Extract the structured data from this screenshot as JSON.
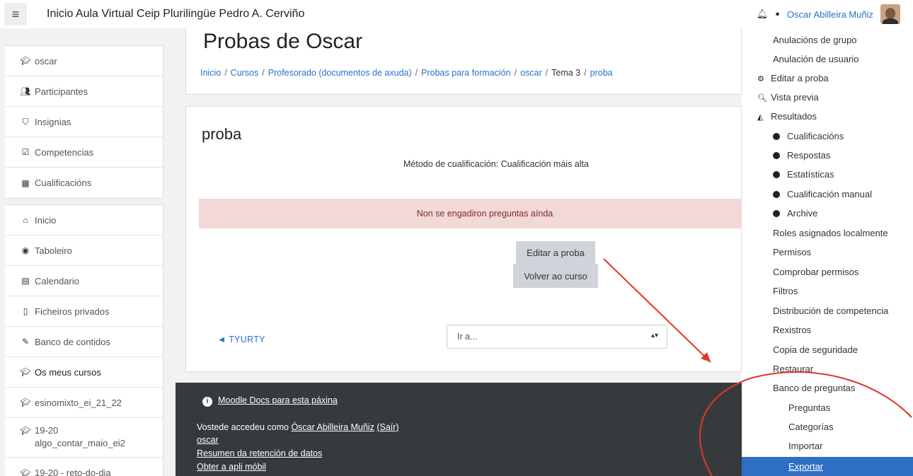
{
  "navbar": {
    "menu_icon": "hamburger-icon",
    "site_title": "Inicio Aula Virtual Ceip Plurilingüe Pedro A. Cerviño",
    "notifications_icon": "bell-icon",
    "messages_icon": "chat-bubble-icon",
    "user_name": "Oscar Abilleira Muñiz"
  },
  "drawer": {
    "group1": [
      {
        "icon": "graduation-cap-icon",
        "glyph": "🎓",
        "label": "oscar"
      },
      {
        "icon": "users-icon",
        "glyph": "👥",
        "label": "Participantes"
      },
      {
        "icon": "shield-icon",
        "glyph": "⛉",
        "label": "Insignias"
      },
      {
        "icon": "checkbox-icon",
        "glyph": "☑",
        "label": "Competencias"
      },
      {
        "icon": "table-icon",
        "glyph": "▦",
        "label": "Cualificacións"
      }
    ],
    "group2": [
      {
        "icon": "home-icon",
        "glyph": "⌂",
        "label": "Inicio"
      },
      {
        "icon": "dashboard-icon",
        "glyph": "◉",
        "label": "Taboleiro"
      },
      {
        "icon": "calendar-icon",
        "glyph": "▤",
        "label": "Calendario"
      },
      {
        "icon": "file-icon",
        "glyph": "🗋",
        "label": "Ficheiros privados"
      },
      {
        "icon": "pencil-icon",
        "glyph": "✎",
        "label": "Banco de contidos"
      },
      {
        "icon": "graduation-cap-icon",
        "glyph": "🎓",
        "label": "Os meus cursos"
      },
      {
        "icon": "graduation-cap-icon",
        "glyph": "🎓",
        "label": "esinomixto_ei_21_22"
      },
      {
        "icon": "graduation-cap-icon",
        "glyph": "🎓",
        "label": "19-20",
        "label2": "algo_contar_maio_ei2"
      },
      {
        "icon": "graduation-cap-icon",
        "glyph": "🎓",
        "label": "19-20 - reto-do-dia"
      }
    ]
  },
  "header": {
    "title": "Probas de Oscar",
    "breadcrumb": [
      "Inicio",
      "Cursos",
      "Profesorado (documentos de axuda)",
      "Probas para formación",
      "oscar",
      "Tema 3",
      "proba"
    ]
  },
  "quiz": {
    "name": "proba",
    "grading_method": "Método de cualificación: Cualificación máis alta",
    "alert": "Non se engadiron preguntas aínda",
    "edit_button": "Editar a proba",
    "back_button": "Volver ao curso",
    "prev_link": "◄ TYURTY",
    "jump_placeholder": "Ir a..."
  },
  "footer": {
    "docs_link": "Moodle Docs para esta páxina",
    "logged_in_prefix": "Vostede accedeu como ",
    "logged_in_user": "Óscar Abilleira Muñiz",
    "logout": "(Saír)",
    "course_link": "oscar",
    "data_retention": "Resumen da retención de datos",
    "mobile_app": "Obter a apli móbil"
  },
  "admin": {
    "items": [
      "Anulacións de grupo",
      "Anulación de usuario",
      "Editar a proba",
      "Vista previa",
      "Resultados",
      "Cualificacións",
      "Respostas",
      "Estatísticas",
      "Cualificación manual",
      "Archive",
      "Roles asignados localmente",
      "Permisos",
      "Comprobar permisos",
      "Filtros",
      "Distribución de competencia",
      "Rexistros",
      "Copia de seguridade",
      "Restaurar",
      "Banco de preguntas",
      "Preguntas",
      "Categorías",
      "Importar",
      "Exportar"
    ]
  },
  "colors": {
    "link": "#2a72c8",
    "footer_bg": "#373a3c",
    "alert_bg": "#f2d8d6",
    "active_bg": "#2e6fc4",
    "annotation": "#e0362c"
  }
}
